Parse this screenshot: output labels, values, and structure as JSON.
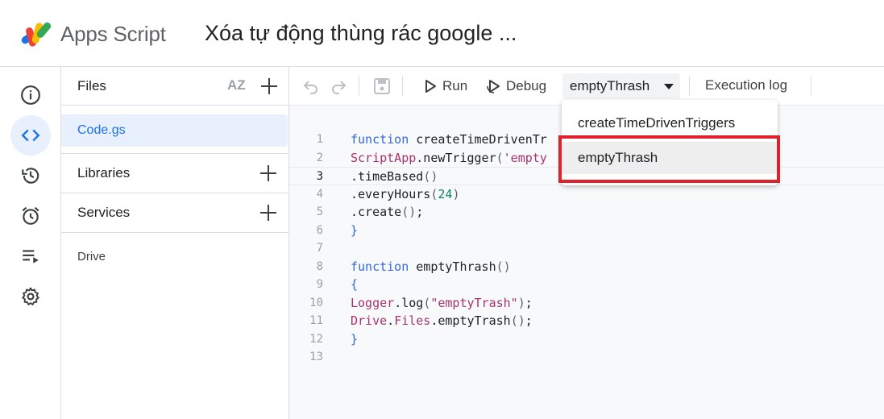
{
  "header": {
    "app_name": "Apps Script",
    "project_title": "Xóa tự động thùng rác google ..."
  },
  "rail": {
    "items": [
      {
        "name": "overview",
        "icon": "info-icon"
      },
      {
        "name": "editor",
        "icon": "code-icon",
        "active": true
      },
      {
        "name": "project-history",
        "icon": "history-icon"
      },
      {
        "name": "triggers",
        "icon": "alarm-icon"
      },
      {
        "name": "executions",
        "icon": "executions-icon"
      },
      {
        "name": "project-settings",
        "icon": "gear-icon"
      }
    ]
  },
  "files": {
    "title": "Files",
    "sort_label": "AZ",
    "file_list": [
      "Code.gs"
    ],
    "libraries_title": "Libraries",
    "services_title": "Services",
    "services_list": [
      "Drive"
    ]
  },
  "toolbar": {
    "run_label": "Run",
    "debug_label": "Debug",
    "selected_function": "emptyThrash",
    "exec_log_label": "Execution log"
  },
  "editor": {
    "lines": [
      {
        "n": "1",
        "code": "function createTimeDrivenTr"
      },
      {
        "n": "2",
        "code": "ScriptApp.newTrigger('empty"
      },
      {
        "n": "3",
        "code": ".timeBased()"
      },
      {
        "n": "4",
        "code": ".everyHours(24)"
      },
      {
        "n": "5",
        "code": ".create();"
      },
      {
        "n": "6",
        "code": "}"
      },
      {
        "n": "7",
        "code": ""
      },
      {
        "n": "8",
        "code": "function emptyThrash()"
      },
      {
        "n": "9",
        "code": "{"
      },
      {
        "n": "10",
        "code": "Logger.log(\"emptyTrash\");"
      },
      {
        "n": "11",
        "code": "Drive.Files.emptyTrash();"
      },
      {
        "n": "12",
        "code": "}"
      },
      {
        "n": "13",
        "code": ""
      }
    ]
  },
  "dropdown": {
    "options": [
      "createTimeDrivenTriggers",
      "emptyThrash"
    ],
    "selected": "emptyThrash"
  },
  "colors": {
    "accent": "#1a73e8",
    "highlight_box": "#e0202a",
    "keyword": "#3367d6",
    "identifier": "#a8326e"
  }
}
